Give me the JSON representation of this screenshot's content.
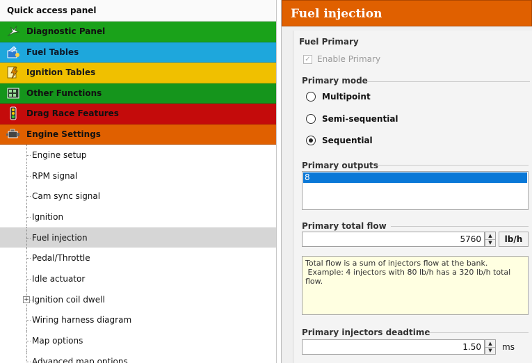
{
  "quick_panel": {
    "title": "Quick access panel",
    "categories": [
      {
        "label": "Diagnostic Panel",
        "color": "#1aa21a",
        "icon": "diagnostic-icon"
      },
      {
        "label": "Fuel Tables",
        "color": "#1ea7dc",
        "icon": "fuel-tables-icon"
      },
      {
        "label": "Ignition Tables",
        "color": "#f0c000",
        "icon": "ignition-tables-icon"
      },
      {
        "label": "Other Functions",
        "color": "#15951c",
        "icon": "other-functions-icon"
      },
      {
        "label": "Drag Race Features",
        "color": "#c40b0b",
        "icon": "drag-race-icon"
      },
      {
        "label": "Engine Settings",
        "color": "#e06000",
        "icon": "engine-icon"
      }
    ],
    "tree": [
      {
        "label": "Engine setup"
      },
      {
        "label": "RPM signal"
      },
      {
        "label": "Cam sync signal"
      },
      {
        "label": "Ignition"
      },
      {
        "label": "Fuel injection",
        "selected": true
      },
      {
        "label": "Pedal/Throttle"
      },
      {
        "label": "Idle actuator"
      },
      {
        "label": "Ignition coil dwell",
        "expandable": true,
        "expander": "+"
      },
      {
        "label": "Wiring harness diagram"
      },
      {
        "label": "Map options"
      },
      {
        "label": "Advanced map options"
      }
    ]
  },
  "panel": {
    "title": "Fuel injection",
    "fuel_primary": {
      "title": "Fuel Primary",
      "enable_label": "Enable Primary",
      "enable_check": "✓"
    },
    "primary_mode": {
      "title": "Primary mode",
      "options": [
        "Multipoint",
        "Semi-sequential",
        "Sequential"
      ],
      "selected": "Sequential"
    },
    "primary_outputs": {
      "title": "Primary outputs",
      "selected_item": "8"
    },
    "primary_total_flow": {
      "title": "Primary total flow",
      "value": "5760",
      "unit": "lb/h"
    },
    "info_text": "Total flow is a sum of injectors flow at the bank.\n Example: 4 injectors with 80 lb/h has a 320 lb/h total flow.",
    "deadtime": {
      "title": "Primary injectors deadtime",
      "value": "1.50",
      "unit": "ms"
    }
  }
}
